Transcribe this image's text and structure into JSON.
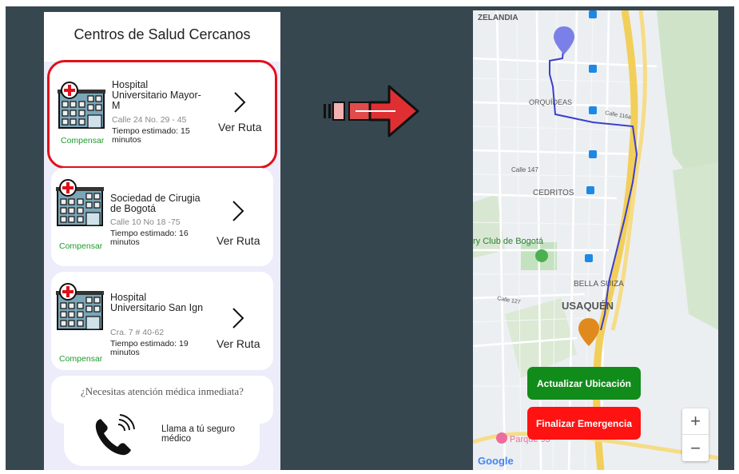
{
  "panel": {
    "title": "Centros de Salud Cercanos",
    "question": "¿Necesitas atención médica inmediata?",
    "call_label": "Llama a tú seguro médico"
  },
  "hospitals": [
    {
      "name": "Hospital Universitario Mayor-M",
      "address": "Calle 24 No. 29 - 45",
      "time": "Tiempo estimado: 15 minutos",
      "insurer": "Compensar",
      "action": "Ver Ruta"
    },
    {
      "name": "Sociedad de Cirugia de Bogotá",
      "address": "Calle 10 No 18 -75",
      "time": "Tiempo estimado: 16 minutos",
      "insurer": "Compensar",
      "action": "Ver Ruta"
    },
    {
      "name": "Hospital Universitario San Ign",
      "address": "Cra. 7 # 40-62",
      "time": "Tiempo estimado: 19 minutos",
      "insurer": "Compensar",
      "action": "Ver Ruta"
    }
  ],
  "map": {
    "labels": {
      "zelandia": "ZELANDIA",
      "orquideas": "ORQUÍDEAS",
      "cedritos": "CEDRITOS",
      "country": "ry Club de Bogotá",
      "bella_suiza": "BELLA SUIZA",
      "usaquen": "USAQUÉN",
      "parque": "Parque 93",
      "calle147": "Calle 147",
      "calle116": "Calle 116a",
      "calle127": "Calle 127"
    },
    "btn_update": "Actualizar Ubicación",
    "btn_finish": "Finalizar Emergencia",
    "zoom_in": "+",
    "zoom_out": "−",
    "attribution": "Google"
  },
  "colors": {
    "route": "#3b3fd0",
    "start_pin": "#7b80e8",
    "end_pin": "#e08a1e",
    "highlight": "#e0101a",
    "insurer": "#1f9a2a"
  }
}
